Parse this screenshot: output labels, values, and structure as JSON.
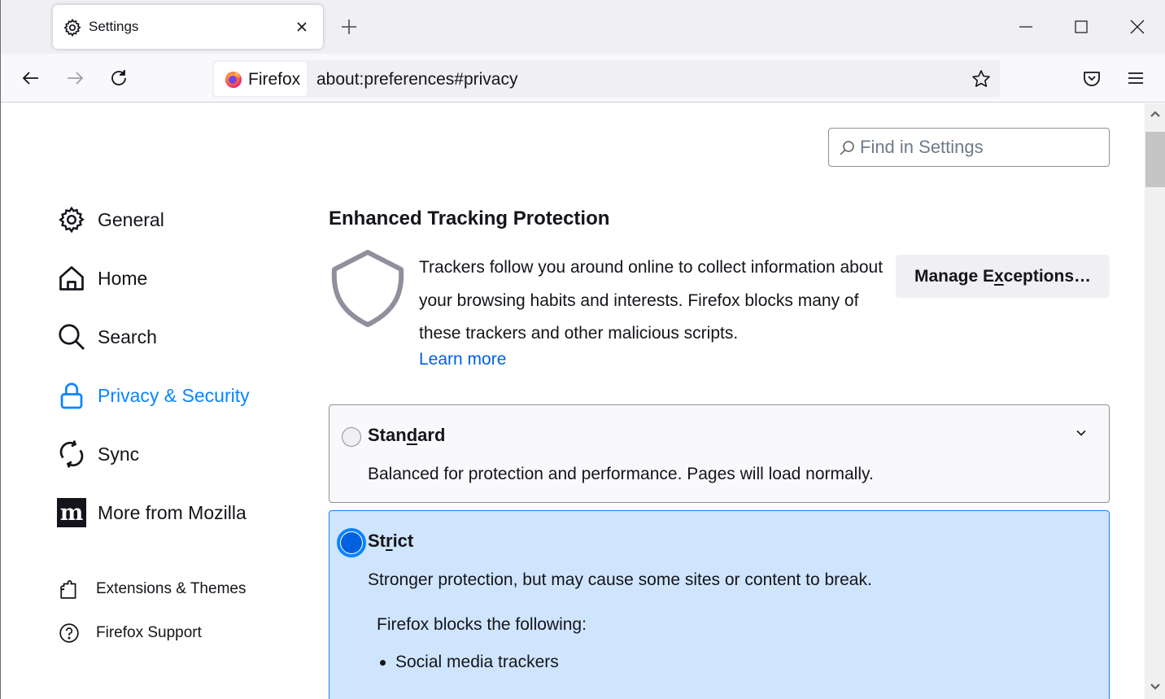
{
  "browser": {
    "tab": {
      "title": "Settings",
      "icon": "gear-icon"
    },
    "new_tab_icon": "plus-icon",
    "window_controls": [
      "minimize-icon",
      "maximize-icon",
      "close-icon"
    ],
    "identity_label": "Firefox",
    "url": "about:preferences#privacy",
    "toolbar_icons": [
      "back-icon",
      "forward-icon",
      "reload-icon",
      "star-icon",
      "pocket-icon",
      "menu-icon"
    ]
  },
  "search": {
    "placeholder": "Find in Settings",
    "value": ""
  },
  "sidebar": {
    "items": [
      {
        "label": "General",
        "icon": "gear-icon",
        "selected": false
      },
      {
        "label": "Home",
        "icon": "home-icon",
        "selected": false
      },
      {
        "label": "Search",
        "icon": "search-icon",
        "selected": false
      },
      {
        "label": "Privacy & Security",
        "icon": "lock-icon",
        "selected": true
      },
      {
        "label": "Sync",
        "icon": "sync-icon",
        "selected": false
      },
      {
        "label": "More from Mozilla",
        "icon": "mozilla-icon",
        "selected": false
      }
    ],
    "footer": [
      {
        "label": "Extensions & Themes",
        "icon": "puzzle-icon"
      },
      {
        "label": "Firefox Support",
        "icon": "help-icon"
      }
    ]
  },
  "main": {
    "section_title": "Enhanced Tracking Protection",
    "description": "Trackers follow you around online to collect information about your browsing habits and interests. Firefox blocks many of these trackers and other malicious scripts.",
    "learn_more": "Learn more",
    "manage_exceptions": {
      "before": "Manage E",
      "accesskey": "x",
      "after": "ceptions…"
    },
    "options": [
      {
        "id": "standard",
        "title_before": "Stan",
        "accesskey": "d",
        "title_after": "ard",
        "description": "Balanced for protection and performance. Pages will load normally.",
        "selected": false
      },
      {
        "id": "strict",
        "title_before": "St",
        "accesskey": "r",
        "title_after": "ict",
        "description": "Stronger protection, but may cause some sites or content to break.",
        "selected": true,
        "blocks_label": "Firefox blocks the following:",
        "blocks": [
          "Social media trackers"
        ]
      }
    ]
  },
  "colors": {
    "accent": "#0a84ff",
    "link": "#0061e0",
    "selected_card": "#cfe5fd"
  }
}
